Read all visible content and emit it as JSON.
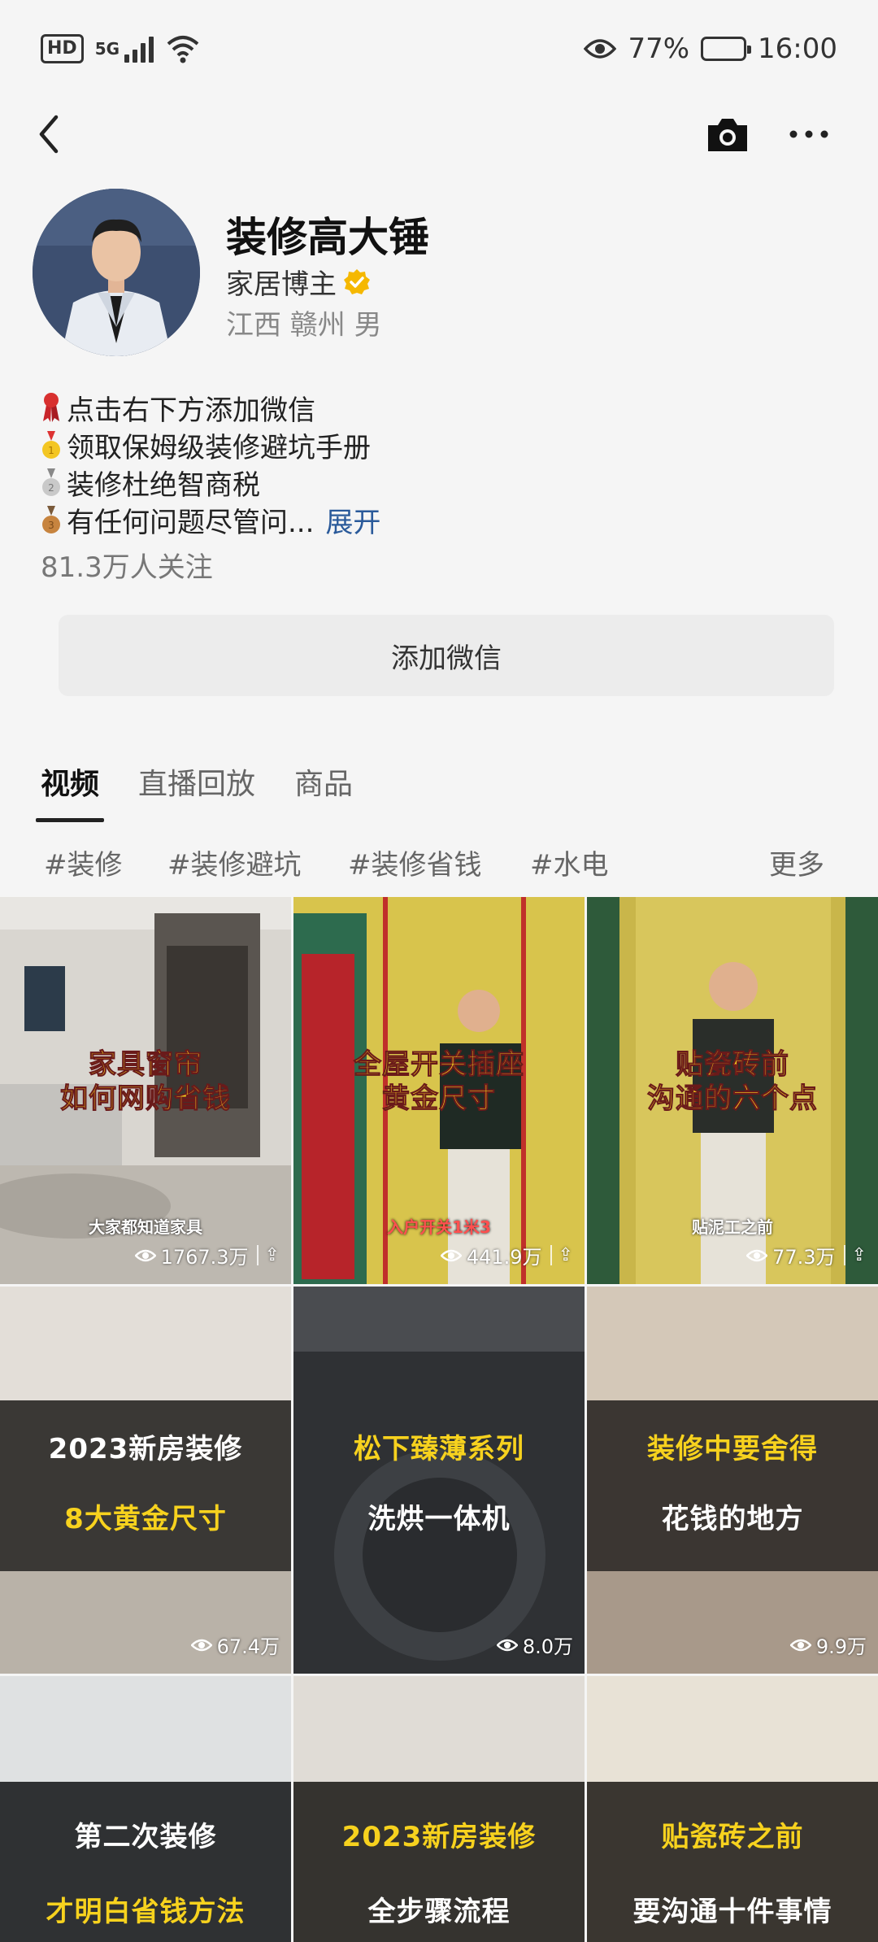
{
  "status_bar": {
    "hd": "HD",
    "network": "5G",
    "battery_pct": "77%",
    "battery_level": 0.77,
    "time": "16:00"
  },
  "profile": {
    "name": "装修高大锤",
    "role": "家居博主",
    "location": "江西 赣州 男",
    "bio": [
      "点击右下方添加微信",
      "领取保姆级装修避坑手册",
      "装修杜绝智商税",
      "有任何问题尽管问..."
    ],
    "expand_label": "展开",
    "followers": "81.3万人关注"
  },
  "add_wechat_label": "添加微信",
  "tabs": [
    "视频",
    "直播回放",
    "商品"
  ],
  "tags": [
    "#装修",
    "#装修避坑",
    "#装修省钱",
    "#水电"
  ],
  "more_label": "更多",
  "videos": [
    {
      "line1": "家具窗帘",
      "line2": "如何网购省钱",
      "sub": "大家都知道家具",
      "views": "1767.3万",
      "pinned": true
    },
    {
      "line1": "全屋开关插座",
      "line2": "黄金尺寸",
      "sub": "入户开关1米3",
      "views": "441.9万",
      "pinned": true
    },
    {
      "line1": "贴瓷砖前",
      "line2": "沟通的六个点",
      "sub": "贴泥工之前",
      "views": "77.3万",
      "pinned": true
    },
    {
      "line1": "2023新房装修",
      "line2": "8大黄金尺寸",
      "views": "67.4万"
    },
    {
      "line1": "松下臻薄系列",
      "line2": "洗烘一体机",
      "views": "8.0万"
    },
    {
      "line1": "装修中要舍得",
      "line2": "花钱的地方",
      "views": "9.9万"
    },
    {
      "line1": "第二次装修",
      "line2": "才明白省钱方法"
    },
    {
      "line1": "2023新房装修",
      "line2": "全步骤流程"
    },
    {
      "line1": "贴瓷砖之前",
      "line2": "要沟通十件事情"
    }
  ],
  "colors": {
    "verified": "#f5b800",
    "link": "#2a5a9a",
    "caption_yellow": "#f7d21e",
    "caption_red": "#e0312b"
  }
}
